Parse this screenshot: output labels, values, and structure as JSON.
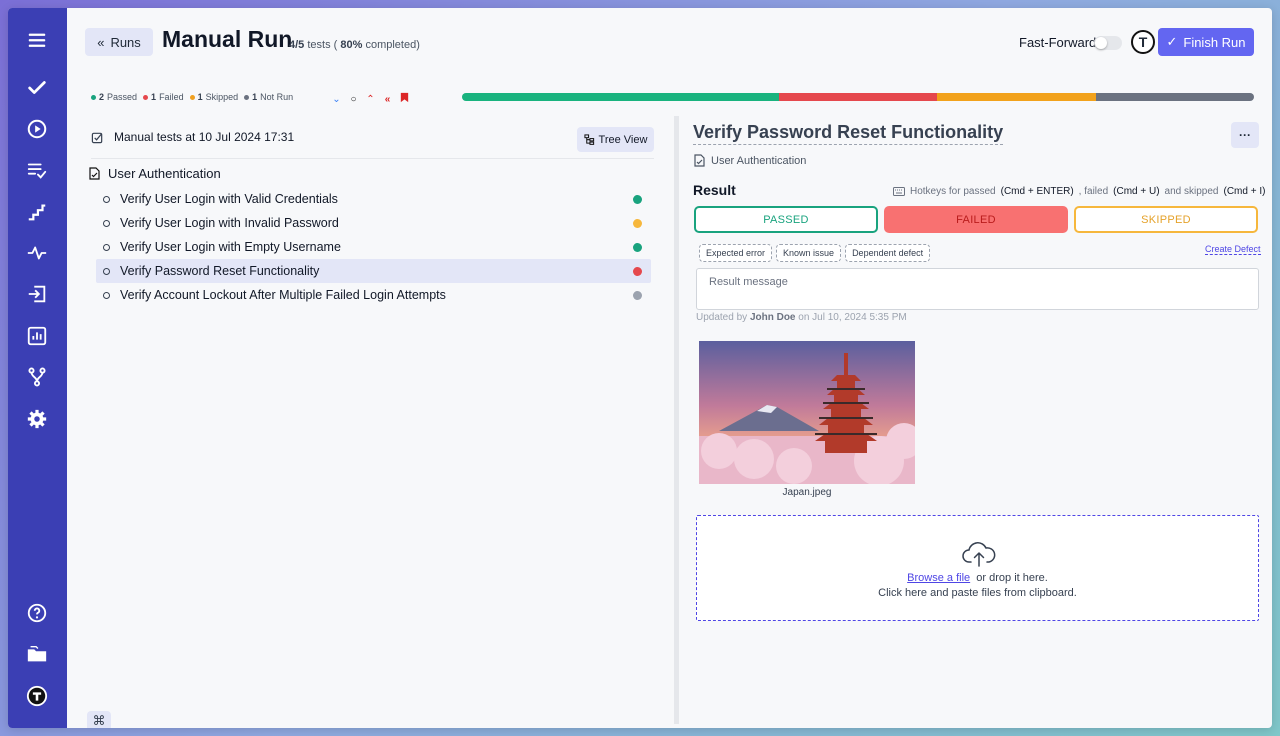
{
  "header": {
    "back_label": "Runs",
    "title": "Manual Run",
    "progress_tests": "4/5",
    "progress_tests_word": "tests (",
    "progress_percent": "80%",
    "progress_completed": "completed)",
    "fast_forward_label": "Fast-Forward",
    "fast_forward_on": false,
    "avatar_letter": "T",
    "finish_label": "Finish Run"
  },
  "stats": {
    "passed": {
      "count": "2",
      "label": "Passed",
      "color": "#19a37e"
    },
    "failed": {
      "count": "1",
      "label": "Failed",
      "color": "#e5484d"
    },
    "skipped": {
      "count": "1",
      "label": "Skipped",
      "color": "#f0a020"
    },
    "not_run": {
      "count": "1",
      "label": "Not Run",
      "color": "#6b7280"
    }
  },
  "progress_bar": [
    {
      "status": "passed",
      "fraction": 0.4,
      "color": "#19b37e"
    },
    {
      "status": "failed",
      "fraction": 0.2,
      "color": "#e5484d"
    },
    {
      "status": "skipped",
      "fraction": 0.2,
      "color": "#f2a21b"
    },
    {
      "status": "not_run",
      "fraction": 0.2,
      "color": "#6b7280"
    }
  ],
  "left": {
    "suite_title": "Manual tests at 10 Jul 2024 17:31",
    "tree_view_label": "Tree View",
    "folder": "User Authentication",
    "cases": [
      {
        "title": "Verify User Login with Valid Credentials",
        "status": "passed",
        "color": "#19a37e"
      },
      {
        "title": "Verify User Login with Invalid Password",
        "status": "skipped",
        "color": "#f6b73c"
      },
      {
        "title": "Verify User Login with Empty Username",
        "status": "passed",
        "color": "#19a37e"
      },
      {
        "title": "Verify Password Reset Functionality",
        "status": "failed",
        "color": "#e5484d",
        "active": true
      },
      {
        "title": "Verify Account Lockout After Multiple Failed Login Attempts",
        "status": "not_run",
        "color": "#9ca3af"
      }
    ]
  },
  "detail": {
    "title": "Verify Password Reset Functionality",
    "more_label": "···",
    "folder": "User Authentication",
    "result_label": "Result",
    "hotkeys_prefix": "Hotkeys for passed",
    "hotkey_passed": "(Cmd + ENTER)",
    "hotkeys_failed": ", failed",
    "hotkey_failed": "(Cmd + U)",
    "hotkeys_skipped": "and skipped",
    "hotkey_skipped": "(Cmd + I)",
    "passed_label": "PASSED",
    "failed_label": "FAILED",
    "skipped_label": "SKIPPED",
    "tags": [
      "Expected error",
      "Known issue",
      "Dependent defect"
    ],
    "create_defect": "Create Defect",
    "result_placeholder": "Result message",
    "updated_prefix": "Updated by",
    "updated_user": "John Doe",
    "updated_suffix": "on Jul 10, 2024 5:35 PM",
    "attachment_name": "Japan.jpeg",
    "browse_label": "Browse a file",
    "drop_text": "or drop it here.",
    "paste_text": "Click here and paste files from clipboard."
  },
  "footer": {
    "cmd_symbol": "⌘",
    "avatar_letter": "T"
  },
  "colors": {
    "sidebar": "#3b3fb4",
    "accent": "#6366f1"
  }
}
